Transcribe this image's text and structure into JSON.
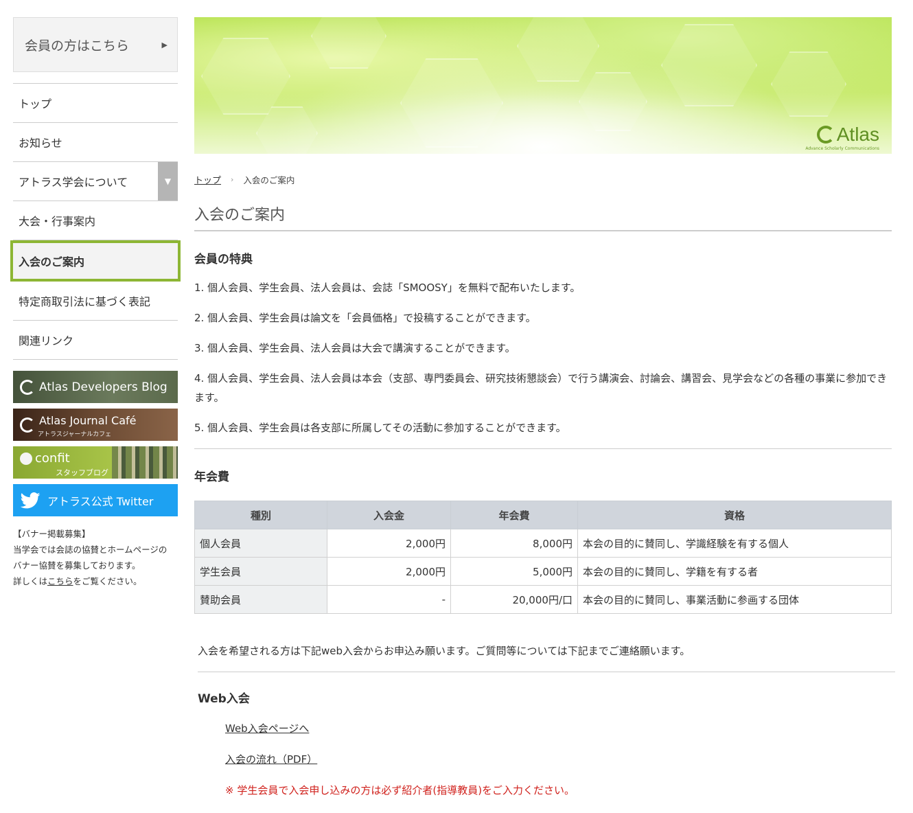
{
  "sidebar": {
    "member_button": {
      "label": "会員の方はこちら",
      "arrow": "▶"
    },
    "nav": [
      {
        "label": "トップ"
      },
      {
        "label": "お知らせ"
      },
      {
        "label": "アトラス学会について",
        "toggle": "▼"
      },
      {
        "label": "大会・行事案内"
      },
      {
        "label": "入会のご案内",
        "active": true
      },
      {
        "label": "特定商取引法に基づく表記"
      },
      {
        "label": "関連リンク"
      }
    ],
    "banners": [
      {
        "title": "Atlas Developers Blog"
      },
      {
        "title": "Atlas Journal Café",
        "sub": "アトラスジャーナルカフェ"
      },
      {
        "title": "confit",
        "sub": "スタッフブログ"
      },
      {
        "title": "アトラス公式 Twitter"
      }
    ],
    "notice": {
      "line1": "【バナー掲載募集】",
      "line2": "当学会では会誌の協賛とホームページの",
      "line3": "バナー協賛を募集しております。",
      "line4_pre": "詳しくは",
      "line4_link": "こちら",
      "line4_post": "をご覧ください。"
    }
  },
  "hero": {
    "brand": "Atlas",
    "tagline": "Advance Scholarly Communications"
  },
  "breadcrumb": {
    "home": "トップ",
    "sep": "›",
    "current": "入会のご案内"
  },
  "page_title": "入会のご案内",
  "benefits": {
    "title": "会員の特典",
    "items": [
      "1. 個人会員、学生会員、法人会員は、会誌「SMOOSY」を無料で配布いたします。",
      "2. 個人会員、学生会員は論文を「会員価格」で投稿することができます。",
      "3. 個人会員、学生会員、法人会員は大会で講演することができます。",
      "4. 個人会員、学生会員、法人会員は本会（支部、専門委員会、研究技術懇談会）で行う講演会、討論会、講習会、見学会などの各種の事業に参加できます。",
      "5. 個人会員、学生会員は各支部に所属してその活動に参加することができます。"
    ]
  },
  "fees": {
    "title": "年会費",
    "headers": [
      "種別",
      "入会金",
      "年会費",
      "資格"
    ],
    "rows": [
      [
        "個人会員",
        "2,000円",
        "8,000円",
        "本会の目的に賛同し、学識経験を有する個人"
      ],
      [
        "学生会員",
        "2,000円",
        "5,000円",
        "本会の目的に賛同し、学籍を有する者"
      ],
      [
        "賛助会員",
        "-",
        "20,000円/口",
        "本会の目的に賛同し、事業活動に参画する団体"
      ]
    ]
  },
  "apply": {
    "intro": "入会を希望される方は下記web入会からお申込み願います。ご質問等については下記までご連絡願います。",
    "web_title": "Web入会",
    "link_web": "Web入会ページへ",
    "link_pdf": "入会の流れ（PDF）",
    "warning": "※ 学生会員で入会申し込みの方は必ず紹介者(指導教員)をご入力ください。"
  }
}
